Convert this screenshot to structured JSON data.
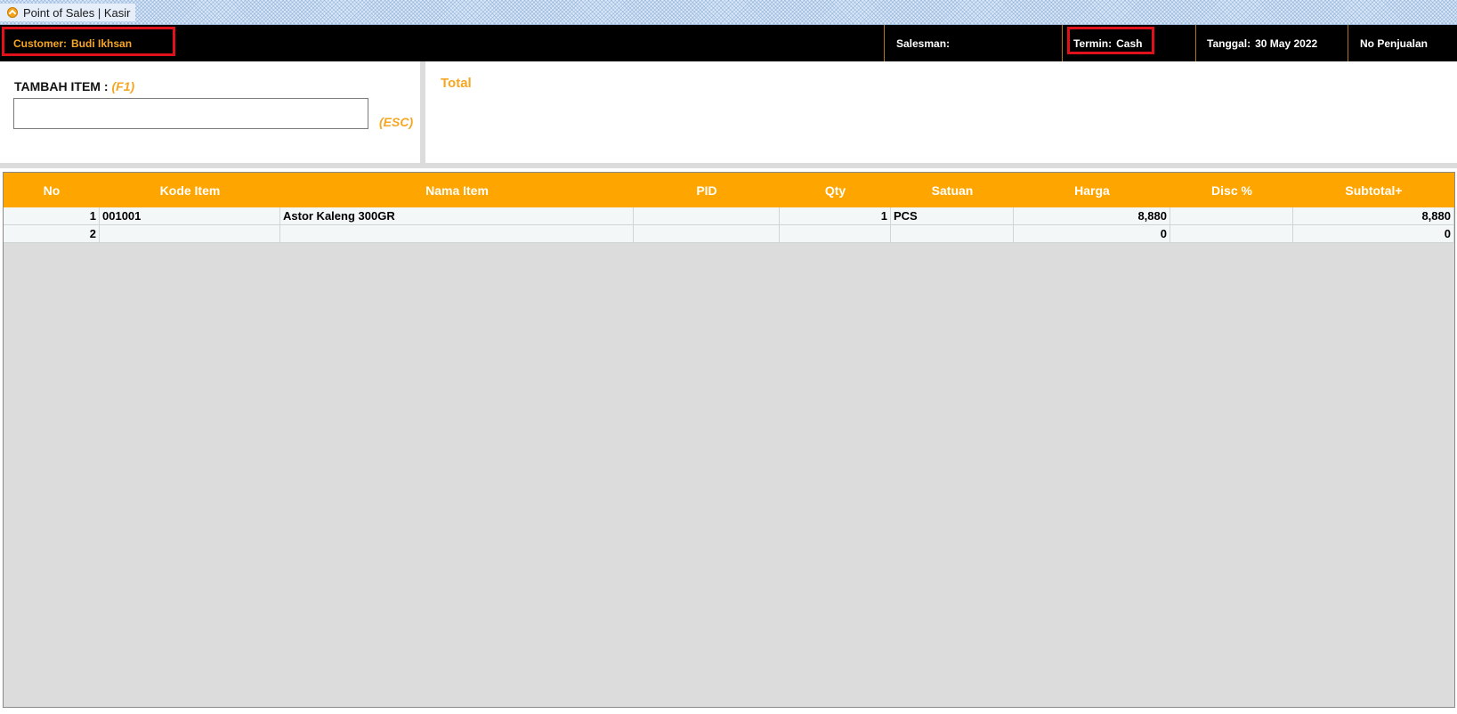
{
  "window": {
    "title": "Point of Sales | Kasir",
    "icon": "app-icon"
  },
  "infobar": {
    "customer_label": "Customer:",
    "customer_value": "Budi Ikhsan",
    "salesman_label": "Salesman:",
    "salesman_value": "",
    "termin_label": "Termin:",
    "termin_value": "Cash",
    "tanggal_label": "Tanggal:",
    "tanggal_value": "30 May 2022",
    "nopenjualan_label": "No Penjualan"
  },
  "add_item": {
    "label": "TAMBAH ITEM :",
    "hotkey": "(F1)",
    "input_value": "",
    "input_placeholder": "",
    "esc_hint": "(ESC)"
  },
  "total": {
    "label": "Total",
    "value": ""
  },
  "grid": {
    "columns": [
      "No",
      "Kode Item",
      "Nama Item",
      "PID",
      "Qty",
      "Satuan",
      "Harga",
      "Disc %",
      "Subtotal+"
    ],
    "rows": [
      {
        "no": "1",
        "kode": "001001",
        "nama": "Astor Kaleng 300GR",
        "pid": "",
        "qty": "1",
        "satuan": "PCS",
        "harga": "8,880",
        "disc": "",
        "subtotal": "8,880"
      },
      {
        "no": "2",
        "kode": "",
        "nama": "",
        "pid": "",
        "qty": "",
        "satuan": "",
        "harga": "0",
        "disc": "",
        "subtotal": "0"
      }
    ]
  },
  "colors": {
    "accent": "#ffa500",
    "highlight": "#e0111b",
    "infobar_bg": "#000000",
    "orange_text": "#f5a623"
  }
}
